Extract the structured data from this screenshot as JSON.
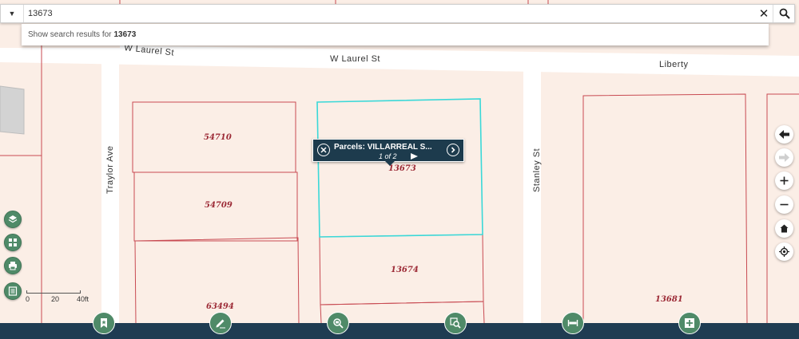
{
  "search": {
    "value": "13673",
    "suggestion_prefix": "Show search results for",
    "suggestion_term": "13673"
  },
  "streets": {
    "laurel_left": "W Laurel St",
    "laurel_main": "W Laurel St",
    "liberty": "Liberty",
    "traylor": "Traylor Ave",
    "stanley": "Stanley St"
  },
  "parcels": {
    "p54710": "54710",
    "p54709": "54709",
    "p63494": "63494",
    "p13673": "13673",
    "p13674": "13674",
    "p13681": "13681"
  },
  "popup": {
    "title": "Parcels: VILLARREAL S...",
    "count": "1 of 2"
  },
  "scale": {
    "t0": "0",
    "t1": "20",
    "t2": "40ft"
  },
  "colors": {
    "parcel_line": "#c84a52",
    "selected_outline": "#3ad8d8",
    "map_background": "#fbeee6",
    "road": "#ffffff",
    "tool_green": "#4f8a68",
    "bar_navy": "#1f3c52"
  },
  "icons": {
    "left_tools": [
      "layers-icon",
      "basemap-grid-icon",
      "print-icon",
      "legend-list-icon"
    ],
    "right_nav": [
      "back-arrow-icon",
      "forward-arrow-icon",
      "zoom-in-icon",
      "zoom-out-icon",
      "home-icon",
      "locate-icon"
    ],
    "bottom_tools": [
      "bookmark-icon",
      "draw-pencil-icon",
      "identify-icon",
      "search-zoom-icon",
      "measure-icon",
      "add-data-icon"
    ]
  }
}
